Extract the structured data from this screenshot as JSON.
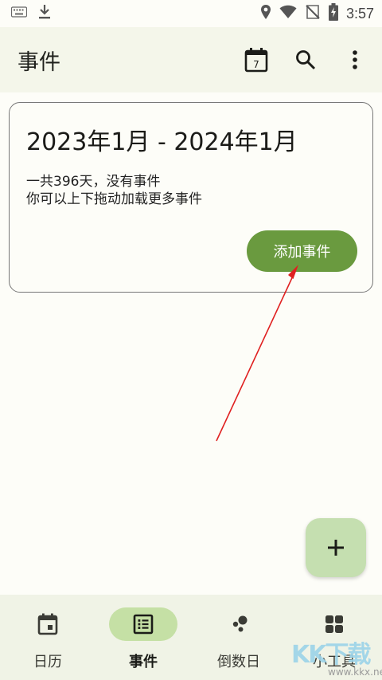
{
  "status_bar": {
    "time": "3:57",
    "icons": [
      "keyboard-icon",
      "download-icon",
      "location-icon",
      "wifi-icon",
      "no-sim-icon",
      "battery-charging-icon"
    ]
  },
  "app_bar": {
    "title": "事件",
    "calendar_day": "7",
    "actions": [
      "calendar-today-icon",
      "search-icon",
      "more-vert-icon"
    ]
  },
  "card": {
    "range": "2023年1月 - 2024年1月",
    "summary_line1": "一共396天，没有事件",
    "summary_line2": "你可以上下拖动加载更多事件",
    "add_button_label": "添加事件"
  },
  "fab": {
    "icon": "plus-icon"
  },
  "bottom_nav": {
    "items": [
      {
        "label": "日历",
        "icon": "calendar-icon",
        "active": false
      },
      {
        "label": "事件",
        "icon": "list-icon",
        "active": true
      },
      {
        "label": "倒数日",
        "icon": "bubbles-icon",
        "active": false
      },
      {
        "label": "小工具",
        "icon": "grid-icon",
        "active": false
      }
    ]
  },
  "watermark": {
    "logo_text": "KK下载",
    "url": "www.kkx.net"
  },
  "colors": {
    "accent": "#6a9a3f",
    "app_bar_bg": "#f4f6ea",
    "nav_bg": "#f0f3e6",
    "active_pill": "#c5e0a5",
    "fab_bg": "#c5dfb0",
    "annotation": "#e02020"
  }
}
